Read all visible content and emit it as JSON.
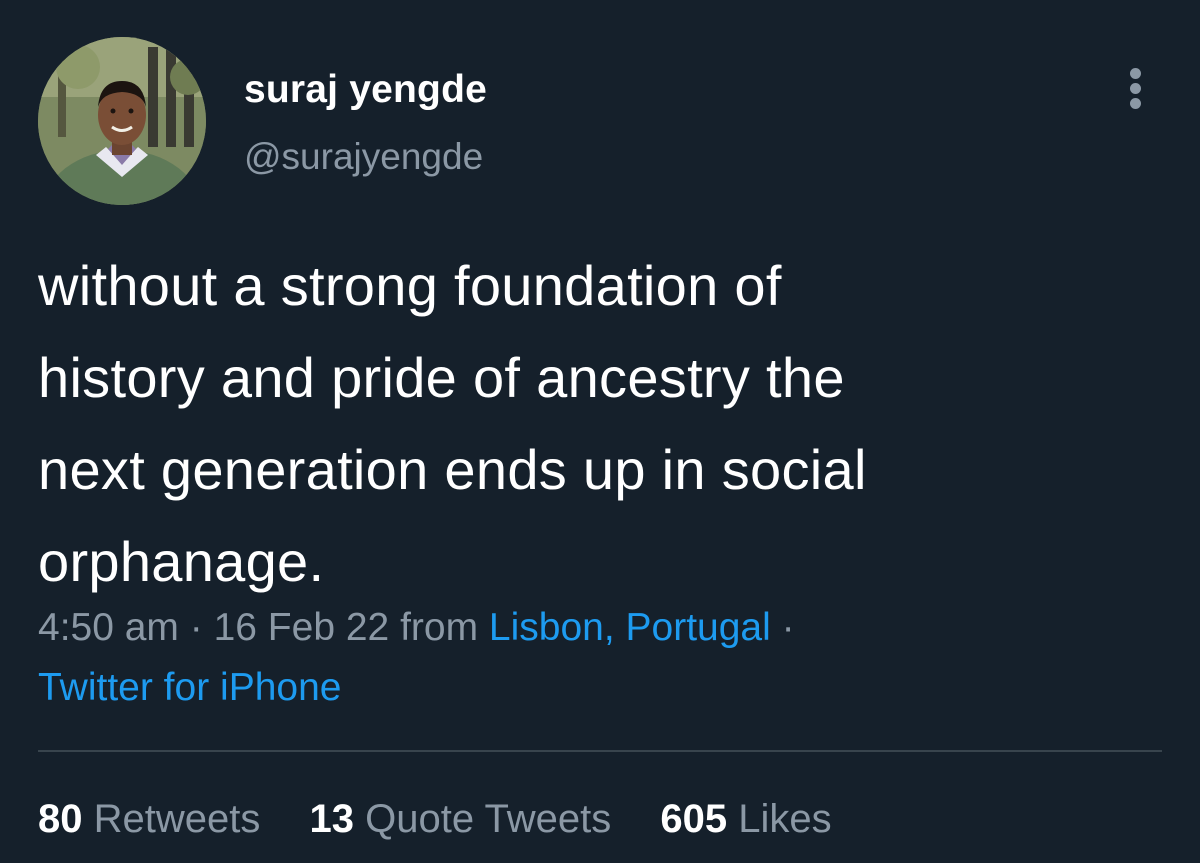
{
  "tweet": {
    "author": {
      "name": "suraj yengde",
      "handle": "@surajyengde"
    },
    "text_lines": [
      "without a strong foundation of",
      "history and pride of ancestry the",
      "next generation ends up in social",
      "orphanage."
    ],
    "meta": {
      "time": "4:50 am",
      "sep1": " · ",
      "date": "16 Feb 22",
      "from_word": " from ",
      "location": "Lisbon, Portugal",
      "sep2": " ·",
      "client": "Twitter for iPhone"
    },
    "stats": {
      "retweets_count": "80",
      "retweets_label": "Retweets",
      "quotes_count": "13",
      "quotes_label": "Quote Tweets",
      "likes_count": "605",
      "likes_label": "Likes"
    }
  },
  "icons": {
    "more": "more-horizontal-icon"
  },
  "colors": {
    "background": "#15202b",
    "primary_text": "#ffffff",
    "secondary_text": "#8b98a5",
    "link": "#1d9bf0",
    "divider": "#38444d"
  }
}
